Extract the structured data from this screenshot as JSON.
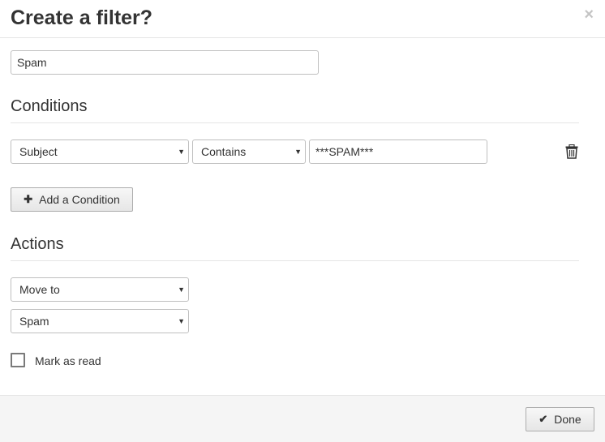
{
  "dialog": {
    "title": "Create a filter?",
    "close_symbol": "×"
  },
  "filter_name": {
    "value": "Spam"
  },
  "conditions": {
    "heading": "Conditions",
    "rows": [
      {
        "field": "Subject",
        "operator": "Contains",
        "value": "***SPAM***"
      }
    ],
    "add_button_label": "Add a Condition",
    "add_icon": "plus-icon",
    "delete_icon": "trash-icon"
  },
  "actions": {
    "heading": "Actions",
    "action": "Move to",
    "target": "Spam",
    "mark_as_read_label": "Mark as read",
    "mark_as_read_checked": false
  },
  "footer": {
    "done_label": "Done",
    "done_icon": "check-icon"
  },
  "colors": {
    "text": "#333333",
    "border": "#bfbfbf",
    "footer_bg": "#f5f5f5",
    "close": "#c4c4c4"
  }
}
